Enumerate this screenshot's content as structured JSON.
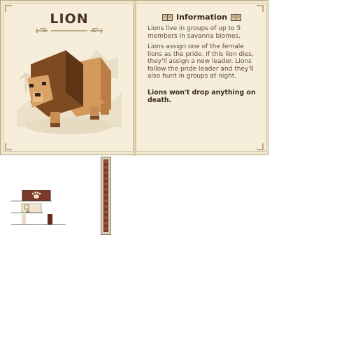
{
  "left_page": {
    "title": "LION"
  },
  "right_page": {
    "header": "Information",
    "paragraphs": [
      "Lions live in groups of up to 5 members in savanna biomes.",
      "Lions assign one of the female lions as the pride. If this lion dies, they'll assign a new leader. Lions follow the pride leader and they'll also hunt in groups at night.",
      "Lions won't drop anything on death."
    ]
  },
  "colors": {
    "parchment": "#f3e9d2",
    "ink": "#4a3424",
    "accent": "#7a3a2a"
  },
  "icons": {
    "header_left": "book-icon",
    "header_right": "book-icon",
    "paw": "paw-icon"
  }
}
